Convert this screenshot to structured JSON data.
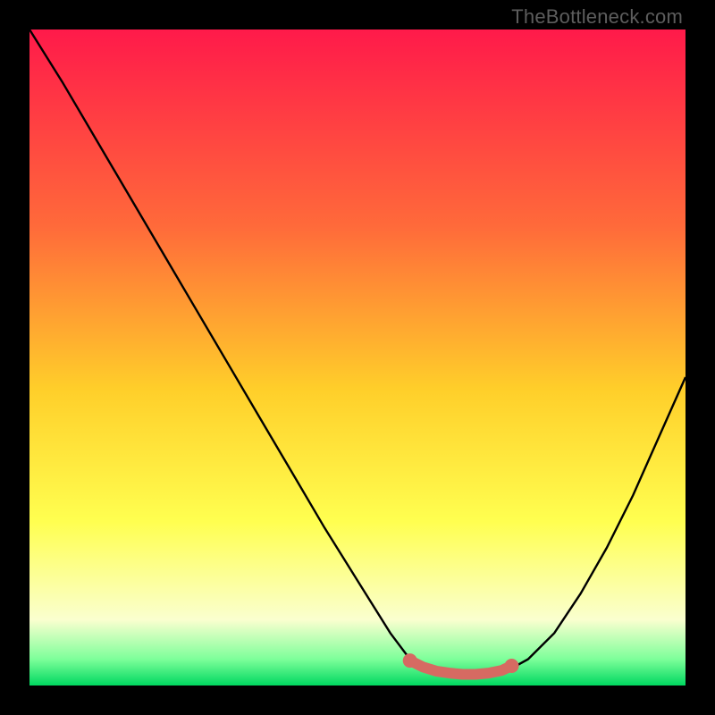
{
  "watermark": "TheBottleneck.com",
  "colors": {
    "gradient_top": "#ff1a4a",
    "gradient_mid1": "#ff6a3a",
    "gradient_mid2": "#ffcf2a",
    "gradient_mid3": "#ffff50",
    "gradient_bottom1": "#faffcf",
    "gradient_bottom2": "#7dff9a",
    "gradient_bottom3": "#00d860",
    "line": "#000000",
    "marker": "#d66a62",
    "marker_stroke": "#b84f48"
  },
  "chart_data": {
    "type": "line",
    "title": "",
    "xlabel": "",
    "ylabel": "",
    "xlim": [
      0,
      100
    ],
    "ylim": [
      0,
      100
    ],
    "series": [
      {
        "name": "bottleneck-curve",
        "x": [
          0,
          5,
          10,
          15,
          20,
          25,
          30,
          35,
          40,
          45,
          50,
          55,
          58,
          60,
          63,
          66,
          69,
          72,
          76,
          80,
          84,
          88,
          92,
          96,
          100
        ],
        "y": [
          100,
          92,
          83.5,
          75,
          66.5,
          58,
          49.5,
          41,
          32.5,
          24,
          16,
          8,
          4,
          2.5,
          1.8,
          1.5,
          1.5,
          1.8,
          4,
          8,
          14,
          21,
          29,
          38,
          47
        ]
      }
    ],
    "markers": {
      "name": "optimal-range",
      "x": [
        58,
        60,
        62,
        64,
        66,
        68,
        70,
        72,
        73.5
      ],
      "y": [
        3.8,
        2.8,
        2.2,
        1.9,
        1.7,
        1.7,
        1.9,
        2.3,
        3.0
      ]
    }
  }
}
